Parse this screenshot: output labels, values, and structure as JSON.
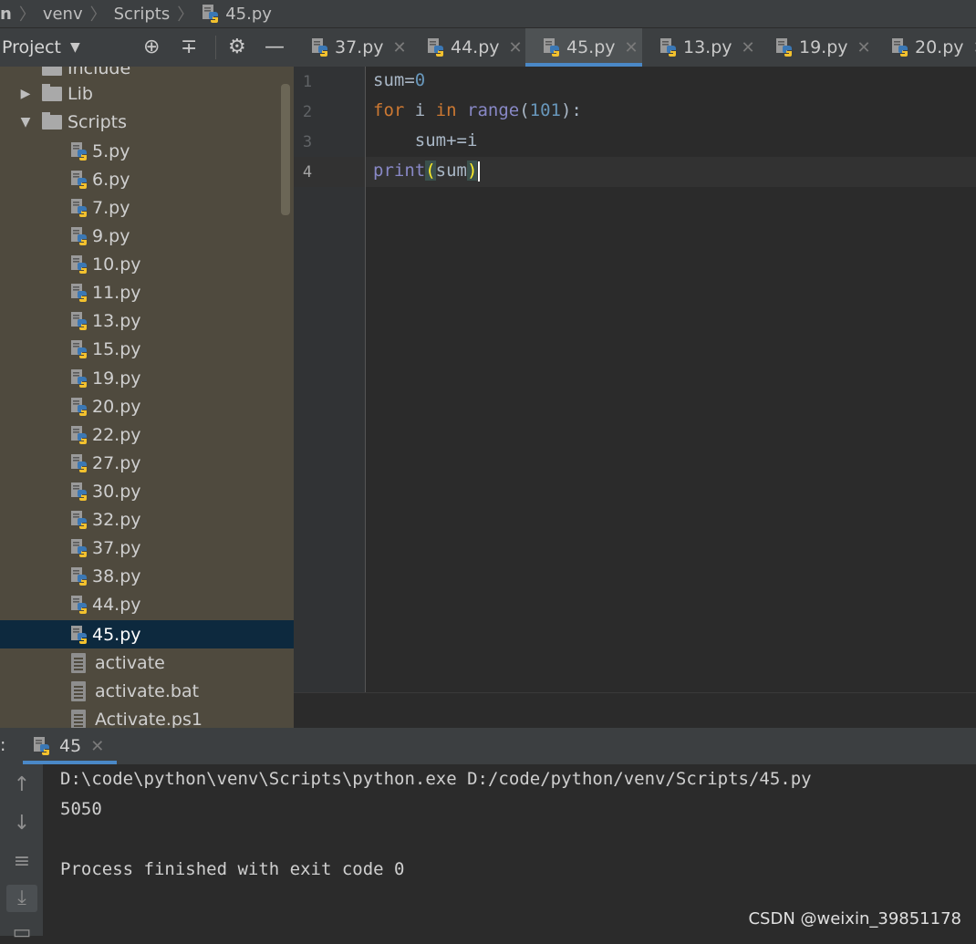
{
  "breadcrumb": {
    "items": [
      "n",
      "venv",
      "Scripts",
      "45.py"
    ]
  },
  "project_panel": {
    "title": "Project",
    "tree": [
      {
        "label": "Include",
        "type": "folder"
      },
      {
        "label": "Lib",
        "type": "folder",
        "expanded": false
      },
      {
        "label": "Scripts",
        "type": "folder",
        "expanded": true
      },
      {
        "label": "5.py",
        "type": "python"
      },
      {
        "label": "6.py",
        "type": "python"
      },
      {
        "label": "7.py",
        "type": "python"
      },
      {
        "label": "9.py",
        "type": "python"
      },
      {
        "label": "10.py",
        "type": "python"
      },
      {
        "label": "11.py",
        "type": "python"
      },
      {
        "label": "13.py",
        "type": "python"
      },
      {
        "label": "15.py",
        "type": "python"
      },
      {
        "label": "19.py",
        "type": "python"
      },
      {
        "label": "20.py",
        "type": "python"
      },
      {
        "label": "22.py",
        "type": "python"
      },
      {
        "label": "27.py",
        "type": "python"
      },
      {
        "label": "30.py",
        "type": "python"
      },
      {
        "label": "32.py",
        "type": "python"
      },
      {
        "label": "37.py",
        "type": "python"
      },
      {
        "label": "38.py",
        "type": "python"
      },
      {
        "label": "44.py",
        "type": "python"
      },
      {
        "label": "45.py",
        "type": "python",
        "selected": true
      },
      {
        "label": "activate",
        "type": "file"
      },
      {
        "label": "activate.bat",
        "type": "file"
      },
      {
        "label": "Activate.ps1",
        "type": "file"
      }
    ]
  },
  "tabs": [
    {
      "label": "37.py",
      "active": false
    },
    {
      "label": "44.py",
      "active": false
    },
    {
      "label": "45.py",
      "active": true
    },
    {
      "label": "13.py",
      "active": false
    },
    {
      "label": "19.py",
      "active": false
    },
    {
      "label": "20.py",
      "active": false
    }
  ],
  "editor": {
    "line_numbers": [
      "1",
      "2",
      "3",
      "4"
    ],
    "lines": [
      {
        "tokens": [
          {
            "t": "sum=",
            "c": "plain"
          },
          {
            "t": "0",
            "c": "num"
          }
        ]
      },
      {
        "tokens": [
          {
            "t": "for",
            "c": "kw"
          },
          {
            "t": " i ",
            "c": "plain"
          },
          {
            "t": "in",
            "c": "kw"
          },
          {
            "t": " ",
            "c": "plain"
          },
          {
            "t": "range",
            "c": "bi"
          },
          {
            "t": "(",
            "c": "plain"
          },
          {
            "t": "101",
            "c": "num"
          },
          {
            "t": "):",
            "c": "plain"
          }
        ]
      },
      {
        "tokens": [
          {
            "t": "    sum+=i",
            "c": "plain"
          }
        ]
      },
      {
        "tokens": [
          {
            "t": "print",
            "c": "bi"
          },
          {
            "t": "(",
            "c": "br"
          },
          {
            "t": "sum",
            "c": "plain"
          },
          {
            "t": ")",
            "c": "br"
          }
        ]
      }
    ]
  },
  "run_panel": {
    "prefix": ":",
    "tab_label": "45",
    "output": [
      "D:\\code\\python\\venv\\Scripts\\python.exe D:/code/python/venv/Scripts/45.py",
      "5050",
      "",
      "Process finished with exit code 0"
    ]
  },
  "watermark": "CSDN @weixin_39851178",
  "colors": {
    "accent": "#4a88c7",
    "selection": "#0d293e",
    "keyword": "#cc7832",
    "number": "#6897bb",
    "builtin": "#8888c6"
  }
}
